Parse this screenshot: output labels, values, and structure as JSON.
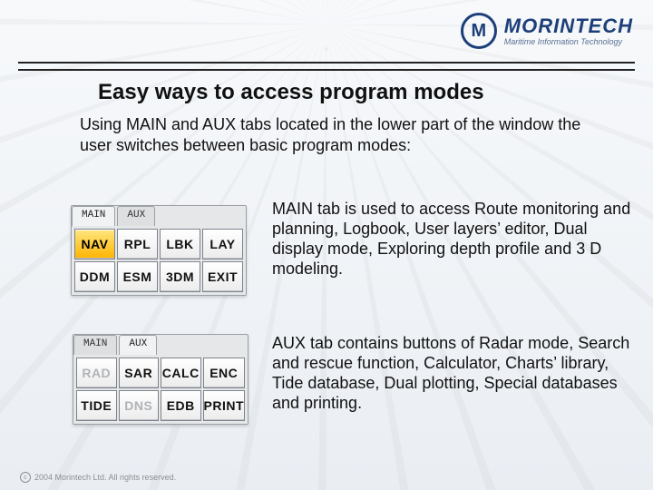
{
  "brand": {
    "name": "MORINTECH",
    "tagline": "Maritime Information Technology",
    "mark_letter": "M"
  },
  "title": "Easy ways to access program modes",
  "intro": "Using MAIN and AUX tabs located in the lower part of the window the user switches between basic program modes:",
  "panels": {
    "main": {
      "tab_active": "MAIN",
      "tab_inactive": "AUX",
      "buttons": [
        "NAV",
        "RPL",
        "LBK",
        "LAY",
        "DDM",
        "ESM",
        "3DM",
        "EXIT"
      ],
      "active_index": 0,
      "disabled_indices": []
    },
    "aux": {
      "tab_inactive": "MAIN",
      "tab_active": "AUX",
      "buttons": [
        "RAD",
        "SAR",
        "CALC",
        "ENC",
        "TIDE",
        "DNS",
        "EDB",
        "PRINT"
      ],
      "active_index": -1,
      "disabled_indices": [
        0,
        5
      ]
    }
  },
  "descriptions": {
    "main": "MAIN tab is used to access Route monitoring and planning, Logbook, User layers’ editor, Dual display mode, Exploring depth profile and 3 D modeling.",
    "aux": "AUX tab contains buttons of Radar mode, Search and rescue function, Calculator, Charts’ library, Tide database, Dual plotting, Special databases and printing."
  },
  "copyright": "2004 Morintech Ltd. All rights reserved."
}
